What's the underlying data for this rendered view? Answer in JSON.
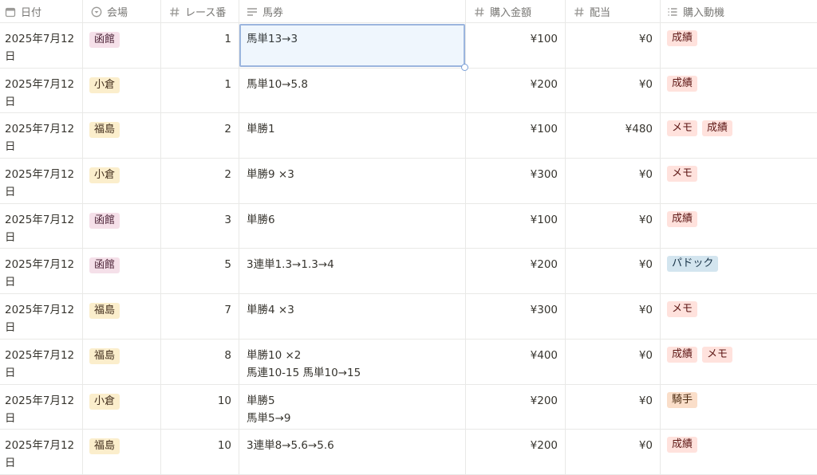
{
  "columns": [
    {
      "label": "日付",
      "icon": "calendar-icon"
    },
    {
      "label": "会場",
      "icon": "select-icon"
    },
    {
      "label": "レース番",
      "icon": "number-icon"
    },
    {
      "label": "馬券",
      "icon": "text-icon"
    },
    {
      "label": "購入金額",
      "icon": "number-icon"
    },
    {
      "label": "配当",
      "icon": "number-icon"
    },
    {
      "label": "購入動機",
      "icon": "multiselect-icon"
    }
  ],
  "colors": {
    "函館": {
      "bg": "#f5e0e9",
      "fg": "#4c2337"
    },
    "小倉": {
      "bg": "#fbeecc",
      "fg": "#402c1b"
    },
    "福島": {
      "bg": "#fbeecc",
      "fg": "#402c1b"
    },
    "成績": {
      "bg": "#ffe2dd",
      "fg": "#5d1715"
    },
    "メモ": {
      "bg": "#ffe2dd",
      "fg": "#5d1715"
    },
    "パドック": {
      "bg": "#d3e5ef",
      "fg": "#183347"
    },
    "騎手": {
      "bg": "#fadec9",
      "fg": "#49290e"
    }
  },
  "rows": [
    {
      "date": "2025年7月12日",
      "venue": "函館",
      "race": "1",
      "ticket": "馬単13→3",
      "amount": "¥100",
      "payout": "¥0",
      "reasons": [
        "成績"
      ]
    },
    {
      "date": "2025年7月12日",
      "venue": "小倉",
      "race": "1",
      "ticket": "馬単10→5.8",
      "amount": "¥200",
      "payout": "¥0",
      "reasons": [
        "成績"
      ]
    },
    {
      "date": "2025年7月12日",
      "venue": "福島",
      "race": "2",
      "ticket": "単勝1",
      "amount": "¥100",
      "payout": "¥480",
      "reasons": [
        "メモ",
        "成績"
      ]
    },
    {
      "date": "2025年7月12日",
      "venue": "小倉",
      "race": "2",
      "ticket": "単勝9 ×3",
      "amount": "¥300",
      "payout": "¥0",
      "reasons": [
        "メモ"
      ]
    },
    {
      "date": "2025年7月12日",
      "venue": "函館",
      "race": "3",
      "ticket": "単勝6",
      "amount": "¥100",
      "payout": "¥0",
      "reasons": [
        "成績"
      ]
    },
    {
      "date": "2025年7月12日",
      "venue": "函館",
      "race": "5",
      "ticket": "3連単1.3→1.3→4",
      "amount": "¥200",
      "payout": "¥0",
      "reasons": [
        "パドック"
      ]
    },
    {
      "date": "2025年7月12日",
      "venue": "福島",
      "race": "7",
      "ticket": "単勝4 ×3",
      "amount": "¥300",
      "payout": "¥0",
      "reasons": [
        "メモ"
      ]
    },
    {
      "date": "2025年7月12日",
      "venue": "福島",
      "race": "8",
      "ticket": "単勝10 ×2\n馬連10-15 馬単10→15",
      "amount": "¥400",
      "payout": "¥0",
      "reasons": [
        "成績",
        "メモ"
      ]
    },
    {
      "date": "2025年7月12日",
      "venue": "小倉",
      "race": "10",
      "ticket": "単勝5\n馬単5→9",
      "amount": "¥200",
      "payout": "¥0",
      "reasons": [
        "騎手"
      ]
    },
    {
      "date": "2025年7月12日",
      "venue": "福島",
      "race": "10",
      "ticket": "3連単8→5.6→5.6",
      "amount": "¥200",
      "payout": "¥0",
      "reasons": [
        "成績"
      ]
    }
  ]
}
